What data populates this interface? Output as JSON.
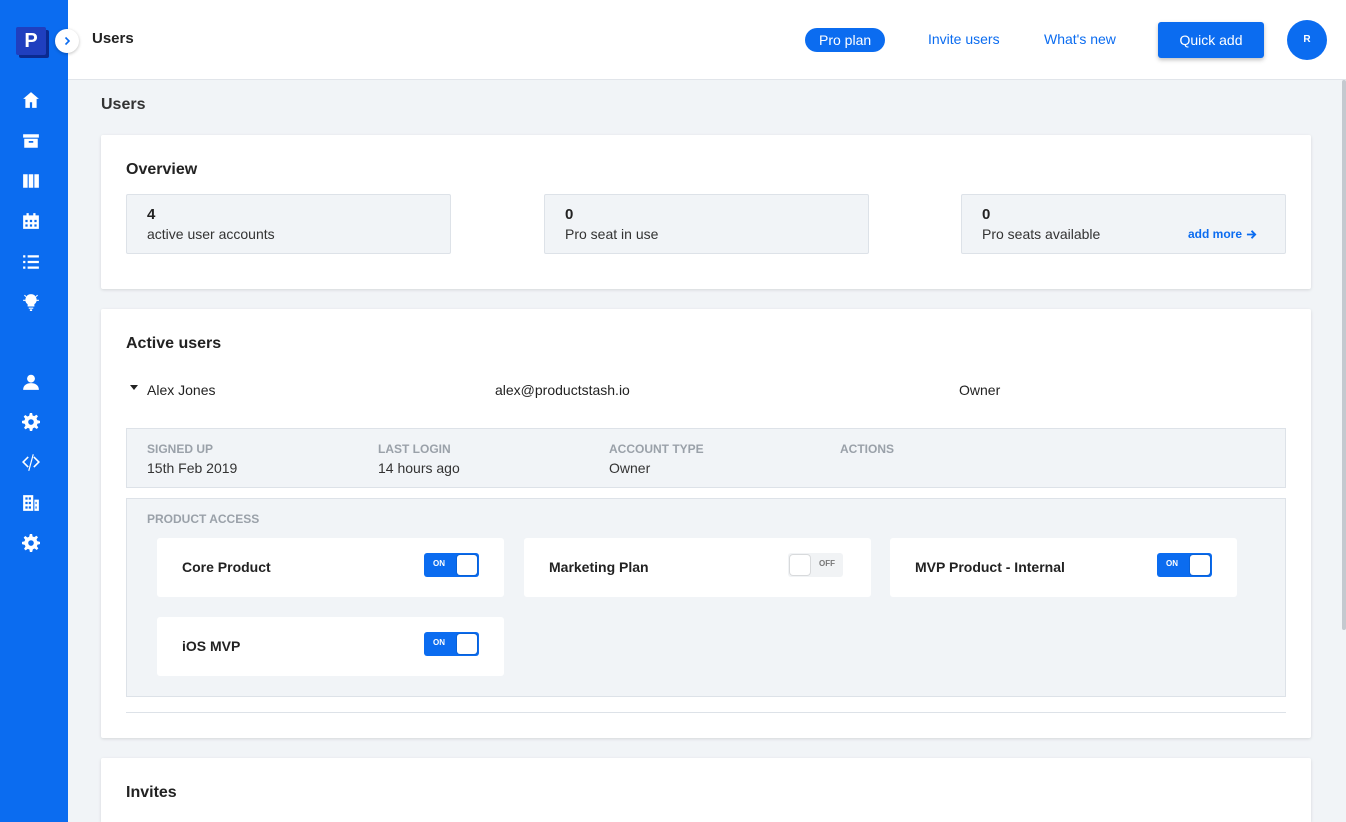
{
  "sidebar": {
    "logo_letter": "P",
    "items": [
      {
        "name": "home-icon"
      },
      {
        "name": "archive-icon"
      },
      {
        "name": "board-icon"
      },
      {
        "name": "calendar-icon"
      },
      {
        "name": "list-icon"
      },
      {
        "name": "lightbulb-icon"
      },
      {
        "name": "user-icon"
      },
      {
        "name": "gear-icon"
      },
      {
        "name": "code-icon"
      },
      {
        "name": "building-icon"
      },
      {
        "name": "api-gear-icon"
      }
    ]
  },
  "header": {
    "title": "Users",
    "pro_plan": "Pro plan",
    "invite_users": "Invite users",
    "whats_new": "What's new",
    "quick_add": "Quick add",
    "avatar_initial": "R"
  },
  "page": {
    "title": "Users"
  },
  "overview": {
    "title": "Overview",
    "stats": [
      {
        "value": "4",
        "label": "active user accounts"
      },
      {
        "value": "0",
        "label": "Pro seat in use"
      },
      {
        "value": "0",
        "label": "Pro seats available"
      }
    ],
    "add_more": "add more"
  },
  "active_users": {
    "title": "Active users",
    "user": {
      "name": "Alex Jones",
      "email": "alex@productstash.io",
      "role": "Owner"
    },
    "details": {
      "signed_up_label": "SIGNED UP",
      "signed_up_value": "15th Feb 2019",
      "last_login_label": "LAST LOGIN",
      "last_login_value": "14 hours ago",
      "account_type_label": "ACCOUNT TYPE",
      "account_type_value": "Owner",
      "actions_label": "ACTIONS"
    },
    "product_access": {
      "label": "PRODUCT ACCESS",
      "products": [
        {
          "name": "Core Product",
          "state": "ON"
        },
        {
          "name": "Marketing Plan",
          "state": "OFF"
        },
        {
          "name": "MVP Product - Internal",
          "state": "ON"
        },
        {
          "name": "iOS MVP",
          "state": "ON"
        }
      ]
    }
  },
  "invites": {
    "title": "Invites"
  },
  "colors": {
    "accent": "#0b6cf0",
    "background": "#f1f4f7"
  }
}
